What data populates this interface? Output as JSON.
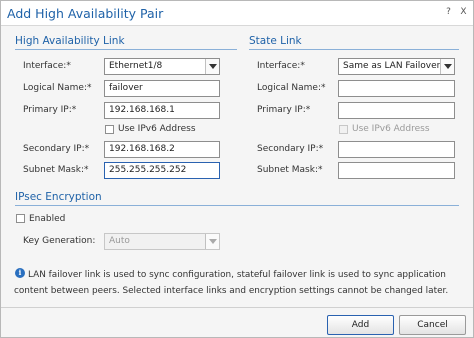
{
  "dialog": {
    "title": "Add High Availability Pair"
  },
  "ha_link": {
    "section_title": "High Availability Link",
    "interface_label": "Interface:*",
    "interface_value": "Ethernet1/8",
    "logical_name_label": "Logical Name:*",
    "logical_name_value": "failover",
    "primary_ip_label": "Primary IP:*",
    "primary_ip_value": "192.168.168.1",
    "use_ipv6_label": "Use IPv6 Address",
    "use_ipv6_checked": false,
    "secondary_ip_label": "Secondary IP:*",
    "secondary_ip_value": "192.168.168.2",
    "subnet_mask_label": "Subnet Mask:*",
    "subnet_mask_value": "255.255.255.252"
  },
  "state_link": {
    "section_title": "State Link",
    "interface_label": "Interface:*",
    "interface_value": "Same as LAN Failover L",
    "logical_name_label": "Logical Name:*",
    "logical_name_value": "",
    "primary_ip_label": "Primary IP:*",
    "primary_ip_value": "",
    "use_ipv6_label": "Use IPv6 Address",
    "use_ipv6_checked": false,
    "secondary_ip_label": "Secondary IP:*",
    "secondary_ip_value": "",
    "subnet_mask_label": "Subnet Mask:*",
    "subnet_mask_value": ""
  },
  "ipsec": {
    "section_title": "IPsec Encryption",
    "enabled_label": "Enabled",
    "enabled_checked": false,
    "key_generation_label": "Key Generation:",
    "key_generation_value": "Auto"
  },
  "info": {
    "icon": "info-icon",
    "message": "LAN failover link is used to sync configuration, stateful failover link is used to sync application content between peers. Selected interface links and encryption settings cannot be changed later."
  },
  "buttons": {
    "add_label": "Add",
    "cancel_label": "Cancel"
  },
  "title_buttons": {
    "help_glyph": "?",
    "close_glyph": "X"
  },
  "colors": {
    "accent": "#1f62a8",
    "section_rule": "#8ab0d8",
    "info_icon": "#2a6fbf"
  }
}
